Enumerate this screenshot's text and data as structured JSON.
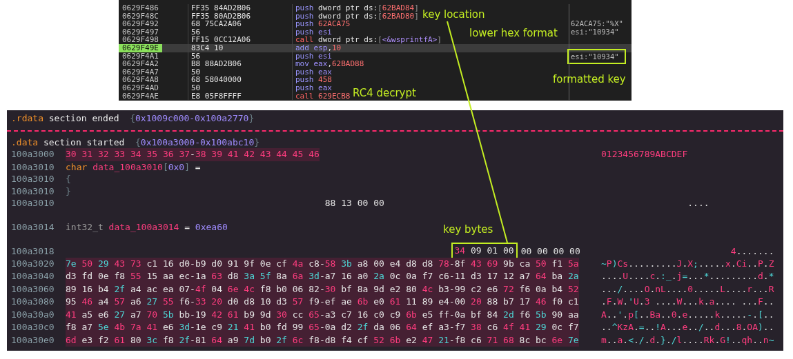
{
  "debugger": {
    "rows": [
      {
        "address": "0629F486",
        "bytes": "FF35 84AD2B06",
        "selected": false,
        "tokens": [
          {
            "text": "push",
            "kind": "op"
          },
          {
            "text": " dword ptr ds:",
            "kind": "text"
          },
          {
            "text": "[",
            "kind": "punct"
          },
          {
            "text": "62BAD84",
            "kind": "num"
          },
          {
            "text": "]",
            "kind": "punct"
          }
        ]
      },
      {
        "address": "0629F48C",
        "bytes": "FF35 80AD2B06",
        "selected": false,
        "tokens": [
          {
            "text": "push",
            "kind": "op"
          },
          {
            "text": " dword ptr ds:",
            "kind": "text"
          },
          {
            "text": "[",
            "kind": "punct"
          },
          {
            "text": "62BAD80",
            "kind": "num"
          },
          {
            "text": "]",
            "kind": "punct"
          }
        ]
      },
      {
        "address": "0629F492",
        "bytes": "68 75CA2A06",
        "selected": false,
        "tokens": [
          {
            "text": "push",
            "kind": "op"
          },
          {
            "text": " 62ACA75",
            "kind": "num"
          }
        ],
        "comment": {
          "text": "62ACA75:\"%X\"",
          "boxed": false
        }
      },
      {
        "address": "0629F497",
        "bytes": "56",
        "selected": false,
        "tokens": [
          {
            "text": "push",
            "kind": "op"
          },
          {
            "text": " esi",
            "kind": "reg"
          }
        ],
        "comment": {
          "text": "esi:\"10934\"",
          "boxed": false
        }
      },
      {
        "address": "0629F498",
        "bytes": "FF15 0CC12A06",
        "selected": false,
        "tokens": [
          {
            "text": "call",
            "kind": "call"
          },
          {
            "text": " dword ptr ds:",
            "kind": "text"
          },
          {
            "text": "[",
            "kind": "punct"
          },
          {
            "text": "<&wsprintfA>",
            "kind": "sym"
          },
          {
            "text": "]",
            "kind": "punct"
          }
        ]
      },
      {
        "address": "0629F49E",
        "bytes": "83C4 10",
        "selected": true,
        "tokens": [
          {
            "text": "add",
            "kind": "op"
          },
          {
            "text": " esp",
            "kind": "reg"
          },
          {
            "text": ",",
            "kind": "text"
          },
          {
            "text": "10",
            "kind": "num"
          }
        ]
      },
      {
        "address": "0629F4A1",
        "bytes": "56",
        "selected": false,
        "tokens": [
          {
            "text": "push",
            "kind": "op"
          },
          {
            "text": " esi",
            "kind": "reg"
          }
        ],
        "comment": {
          "text": "esi:\"10934\"",
          "boxed": true
        }
      },
      {
        "address": "0629F4A2",
        "bytes": "B8 88AD2B06",
        "selected": false,
        "tokens": [
          {
            "text": "mov",
            "kind": "op"
          },
          {
            "text": " eax",
            "kind": "reg"
          },
          {
            "text": ",",
            "kind": "text"
          },
          {
            "text": "62BAD88",
            "kind": "num"
          }
        ]
      },
      {
        "address": "0629F4A7",
        "bytes": "50",
        "selected": false,
        "tokens": [
          {
            "text": "push",
            "kind": "op"
          },
          {
            "text": " eax",
            "kind": "reg"
          }
        ]
      },
      {
        "address": "0629F4A8",
        "bytes": "68 58040000",
        "selected": false,
        "tokens": [
          {
            "text": "push",
            "kind": "op"
          },
          {
            "text": " 458",
            "kind": "num"
          }
        ]
      },
      {
        "address": "0629F4AD",
        "bytes": "50",
        "selected": false,
        "tokens": [
          {
            "text": "push",
            "kind": "op"
          },
          {
            "text": " eax",
            "kind": "reg"
          }
        ]
      },
      {
        "address": "0629F4AE",
        "bytes": "E8 05F8FFFF",
        "selected": false,
        "tokens": [
          {
            "text": "call",
            "kind": "call"
          },
          {
            "text": " 629ECB8",
            "kind": "num"
          }
        ]
      }
    ]
  },
  "listing": {
    "lines": [
      {
        "kind": "code",
        "tokens": [
          {
            "text": ".rdata",
            "kind": "section"
          },
          {
            "text": " section ended  ",
            "kind": "plain"
          },
          {
            "text": "{",
            "kind": "brace"
          },
          {
            "text": "0x1009c000-0x100a2770",
            "kind": "range"
          },
          {
            "text": "}",
            "kind": "brace"
          }
        ]
      },
      {
        "kind": "separator"
      },
      {
        "kind": "code",
        "tokens": [
          {
            "text": ".data",
            "kind": "section"
          },
          {
            "text": " section started  ",
            "kind": "plain"
          },
          {
            "text": "{",
            "kind": "brace"
          },
          {
            "text": "0x100a3000-0x100abc10",
            "kind": "range"
          },
          {
            "text": "}",
            "kind": "brace"
          }
        ]
      },
      {
        "kind": "bytes",
        "address": "100a3000",
        "hex": "30 31 32 33 34 35 36 37-38 39 41 42 43 44 45 46",
        "ascii": "0123456789ABCDEF",
        "highlighted": true
      },
      {
        "kind": "code",
        "address": "100a3010",
        "tokens": [
          {
            "text": "char",
            "kind": "type"
          },
          {
            "text": " data_100a3010",
            "kind": "name"
          },
          {
            "text": "[",
            "kind": "brace"
          },
          {
            "text": "0x0",
            "kind": "num"
          },
          {
            "text": "]",
            "kind": "brace"
          },
          {
            "text": " =",
            "kind": "plain"
          }
        ]
      },
      {
        "kind": "code",
        "address": "100a3010",
        "tokens": [
          {
            "text": "{",
            "kind": "brace"
          }
        ]
      },
      {
        "kind": "code",
        "address": "100a3010",
        "tokens": [
          {
            "text": "}",
            "kind": "brace"
          }
        ]
      },
      {
        "kind": "bytes",
        "address": "100a3010",
        "hex": "88 13 00 00",
        "ascii": "....",
        "highlighted": false
      },
      {
        "kind": "blank"
      },
      {
        "kind": "code",
        "address": "100a3014",
        "tokens": [
          {
            "text": "int32_t",
            "kind": "dimtype"
          },
          {
            "text": " data_100a3014",
            "kind": "name"
          },
          {
            "text": " = ",
            "kind": "plain"
          },
          {
            "text": "0xea60",
            "kind": "num"
          }
        ]
      },
      {
        "kind": "blank"
      },
      {
        "kind": "bytes",
        "address": "100a3018",
        "marked_hex": "34 09 01 00",
        "hex": "00 00 00 00",
        "ascii": "4.......",
        "highlighted": false
      },
      {
        "kind": "bytes",
        "address": "100a3020",
        "hex": "7e 50 29 43 73 c1 16 d0-b9 d0 91 9f 0e cf 4a c8-58 3b a8 00 e4 d8 d8 78-8f 43 69 9b ca 50 f1 5a",
        "ascii": "~P)Cs.........J.X;.....x.Ci..P.Z",
        "highlighted": true
      },
      {
        "kind": "bytes",
        "address": "100a3040",
        "hex": "d3 fd 0e f8 55 15 aa ec-1a 63 d8 3a 5f 8a 6a 3d-a7 16 a0 2a 0c 0a f7 c6-11 d3 17 12 a7 64 ba 2a",
        "ascii": "....U....c.:_.j=...*.........d.*",
        "highlighted": true
      },
      {
        "kind": "bytes",
        "address": "100a3060",
        "hex": "89 16 b4 2f a4 ac ea 07-4f 04 6e 4c f8 b0 06 82-30 bf 8a 9d e2 80 4c b3-99 c2 e6 72 f6 0a b4 52",
        "ascii": ".../....O.nL....0.....L....r...R",
        "highlighted": true
      },
      {
        "kind": "bytes",
        "address": "100a3080",
        "hex": "95 46 a4 57 a6 27 55 f6-33 20 d0 d8 10 d3 57 f9-ef ae 6b e0 61 11 89 e4-00 20 88 b7 17 46 f0 c1",
        "ascii": ".F.W.'U.3 ....W...k.a.... ...F..",
        "highlighted": true
      },
      {
        "kind": "bytes",
        "address": "100a30a0",
        "hex": "41 a5 e6 27 a7 70 5b bb-19 42 61 b9 9d 30 cc 65-a3 c7 16 c0 c9 6b e5 ff-0a bf 84 2d f6 5b 90 aa",
        "ascii": "A..'.p[..Ba..0.e.....k.....-.[..",
        "highlighted": true
      },
      {
        "kind": "bytes",
        "address": "100a30c0",
        "hex": "f8 a7 5e 4b 7a 41 e6 3d-1e c9 21 41 b0 fd 99 65-0a d2 2f da 06 64 ef a3-f7 38 c6 4f 41 29 0c f7",
        "ascii": "..^KzA.=..!A...e../..d...8.OA)..",
        "highlighted": true
      },
      {
        "kind": "bytes",
        "address": "100a30e0",
        "hex": "6d e3 f2 61 80 3c f8 2f-81 64 a9 7d b0 2f 6c f8-d8 f4 cf 52 6b e2 47 21-f8 c6 71 68 8c bc 6e 7e",
        "ascii": "m..a.<./.d.}./l....Rk.G!..qh..n~",
        "highlighted": true
      }
    ]
  },
  "annotations": [
    "key location",
    "lower hex format",
    "formatted key",
    "RC4 decrypt",
    "key bytes"
  ]
}
